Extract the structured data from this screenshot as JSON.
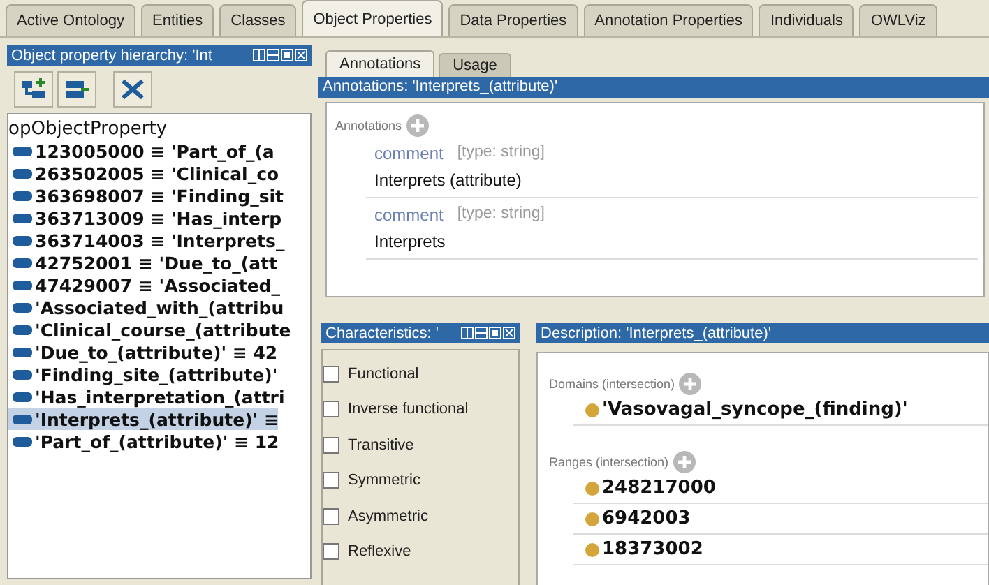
{
  "tabs": [
    {
      "label": "Active Ontology",
      "selected": false
    },
    {
      "label": "Entities",
      "selected": false
    },
    {
      "label": "Classes",
      "selected": false
    },
    {
      "label": "Object Properties",
      "selected": true
    },
    {
      "label": "Data Properties",
      "selected": false
    },
    {
      "label": "Annotation Properties",
      "selected": false
    },
    {
      "label": "Individuals",
      "selected": false
    },
    {
      "label": "OWLViz",
      "selected": false
    }
  ],
  "hierarchy_panel": {
    "title": "Object property hierarchy: 'Int",
    "tree": [
      {
        "label": "opObjectProperty",
        "selected": false,
        "children": [
          {
            "label": "123005000 ≡ 'Part_of_(a",
            "selected": false
          },
          {
            "label": "263502005 ≡ 'Clinical_co",
            "selected": false
          },
          {
            "label": "363698007 ≡ 'Finding_sit",
            "selected": false
          },
          {
            "label": "363713009 ≡ 'Has_interp",
            "selected": false
          },
          {
            "label": "363714003 ≡ 'Interprets_",
            "selected": false
          },
          {
            "label": "42752001 ≡ 'Due_to_(att",
            "selected": false
          },
          {
            "label": "47429007 ≡ 'Associated_",
            "selected": false
          },
          {
            "label": "'Associated_with_(attribu",
            "selected": false
          },
          {
            "label": "'Clinical_course_(attribute",
            "selected": false
          },
          {
            "label": "'Due_to_(attribute)' ≡ 42",
            "selected": false
          },
          {
            "label": "'Finding_site_(attribute)'",
            "selected": false
          },
          {
            "label": "'Has_interpretation_(attri",
            "selected": false
          },
          {
            "label": "'Interprets_(attribute)' ≡",
            "selected": true
          },
          {
            "label": "'Part_of_(attribute)' ≡ 12",
            "selected": false
          }
        ]
      }
    ]
  },
  "property_tabs": [
    {
      "label": "Annotations",
      "selected": true
    },
    {
      "label": "Usage",
      "selected": false
    }
  ],
  "annotations_panel": {
    "title": "Annotations: 'Interprets_(attribute)'",
    "section_label": "Annotations",
    "items": [
      {
        "property": "comment",
        "type": "[type: string]",
        "value": "Interprets (attribute)"
      },
      {
        "property": "comment",
        "type": "[type: string]",
        "value": "Interprets"
      }
    ]
  },
  "characteristics_panel": {
    "title": "Characteristics: '",
    "items": [
      {
        "label": "Functional",
        "checked": false
      },
      {
        "label": "Inverse functional",
        "checked": false
      },
      {
        "label": "Transitive",
        "checked": false
      },
      {
        "label": "Symmetric",
        "checked": false
      },
      {
        "label": "Asymmetric",
        "checked": false
      },
      {
        "label": "Reflexive",
        "checked": false
      }
    ]
  },
  "description_panel": {
    "title": "Description: 'Interprets_(attribute)'",
    "sections": [
      {
        "label": "Domains (intersection)",
        "items": [
          "'Vasovagal_syncope_(finding)'"
        ]
      },
      {
        "label": "Ranges (intersection)",
        "items": [
          "248217000",
          "6942003",
          "18373002"
        ]
      }
    ]
  }
}
